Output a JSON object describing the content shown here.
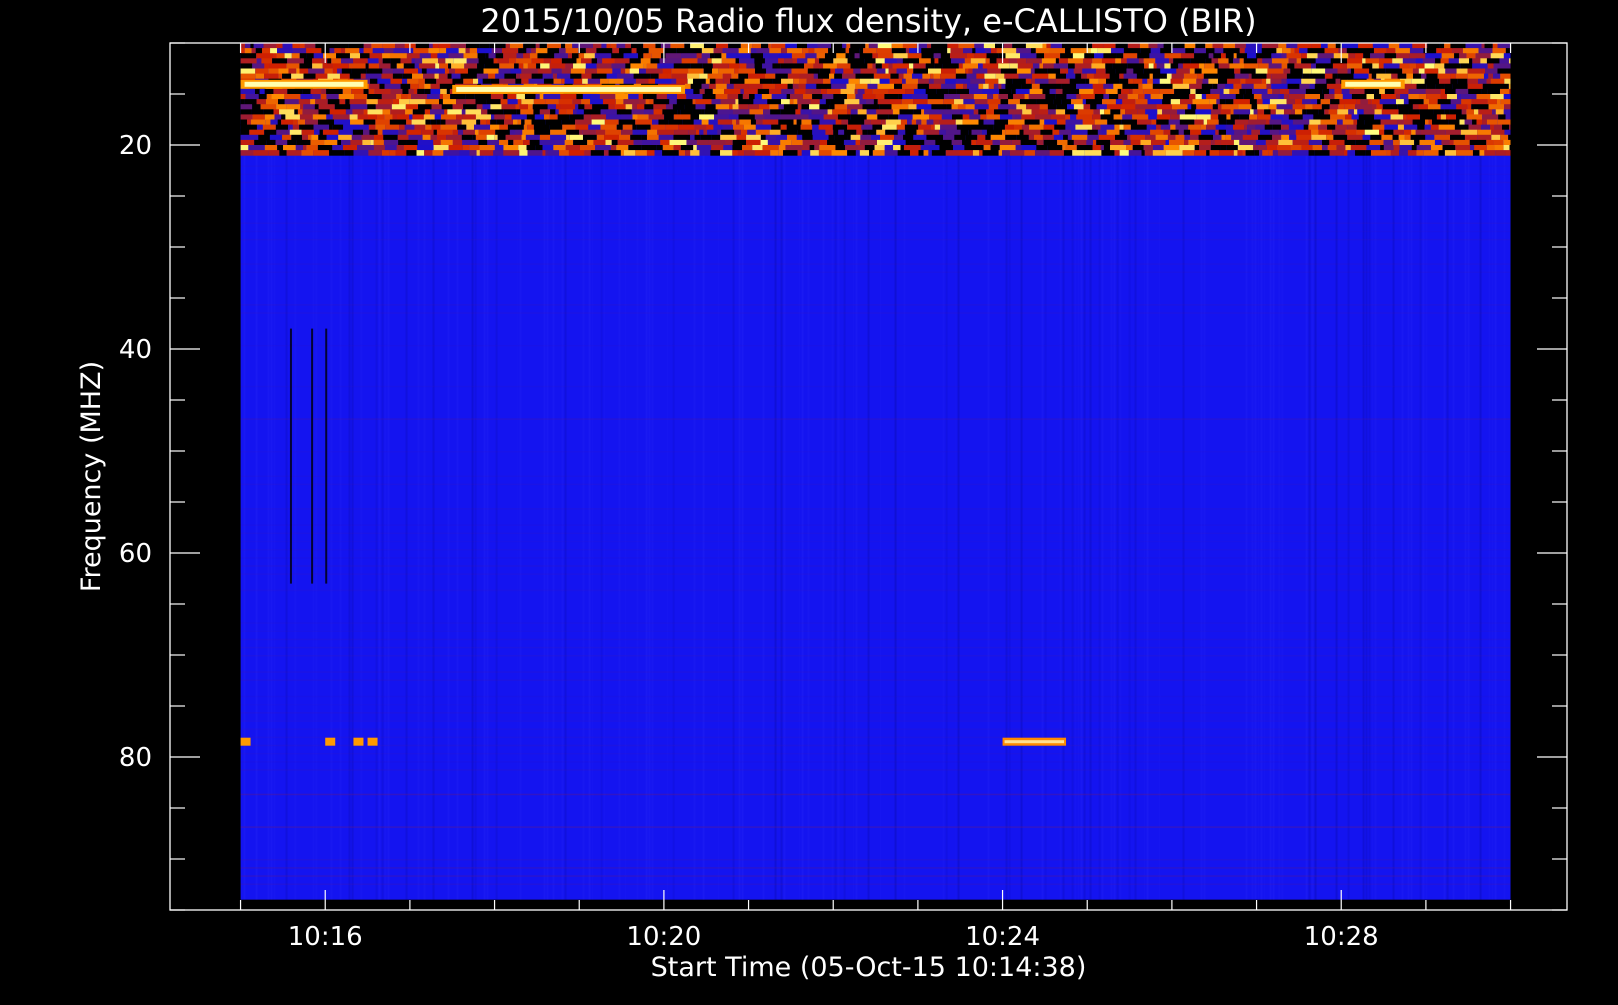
{
  "chart_data": {
    "type": "heatmap",
    "title": "2015/10/05  Radio flux density, e-CALLISTO (BIR)",
    "xlabel": "Start Time (05-Oct-15 10:14:38)",
    "ylabel": "Frequency (MHZ)",
    "xlim": [
      "10:14:10",
      "10:30:40"
    ],
    "ylim": [
      95,
      10
    ],
    "data_x_range": [
      "10:15:00",
      "10:30:00"
    ],
    "data_y_range": [
      94,
      10
    ],
    "x_ticks": [
      "10:16",
      "10:20",
      "10:24",
      "10:28"
    ],
    "y_ticks": [
      20,
      40,
      60,
      80
    ],
    "x_minor_every_minutes": 1,
    "y_minor_every": 5,
    "colormap": [
      "#000000",
      "#1a0fd0",
      "#7a1a55",
      "#d02000",
      "#ff8c00",
      "#ffff80"
    ],
    "background_color": "#1414f0",
    "features": [
      {
        "description_code": "rfi_band",
        "freq_range": [
          10,
          21
        ],
        "time_range": [
          "10:15:00",
          "10:30:00"
        ],
        "intensity": 0.8
      },
      {
        "description_code": "bright_band",
        "freq": 14.5,
        "time_range": [
          "10:17:30",
          "10:20:15"
        ],
        "intensity": 1.0
      },
      {
        "description_code": "bright_band",
        "freq": 14,
        "time_range": [
          "10:15:00",
          "10:16:30"
        ],
        "intensity": 0.9
      },
      {
        "description_code": "bright_band",
        "freq": 14,
        "time_range": [
          "10:28:00",
          "10:28:45"
        ],
        "intensity": 0.9
      },
      {
        "description_code": "bright_line",
        "freq": 78.5,
        "time_range": [
          "10:24:00",
          "10:24:45"
        ],
        "intensity": 1.0
      },
      {
        "description_code": "bright_dots",
        "freq": 78.5,
        "times": [
          "10:15:00",
          "10:16:00",
          "10:16:20",
          "10:16:30"
        ],
        "intensity": 0.9
      },
      {
        "description_code": "dark_streaks",
        "freq_range": [
          38,
          63
        ],
        "times": [
          "10:15:35",
          "10:15:50",
          "10:16:00"
        ],
        "intensity": 0.0
      }
    ]
  }
}
